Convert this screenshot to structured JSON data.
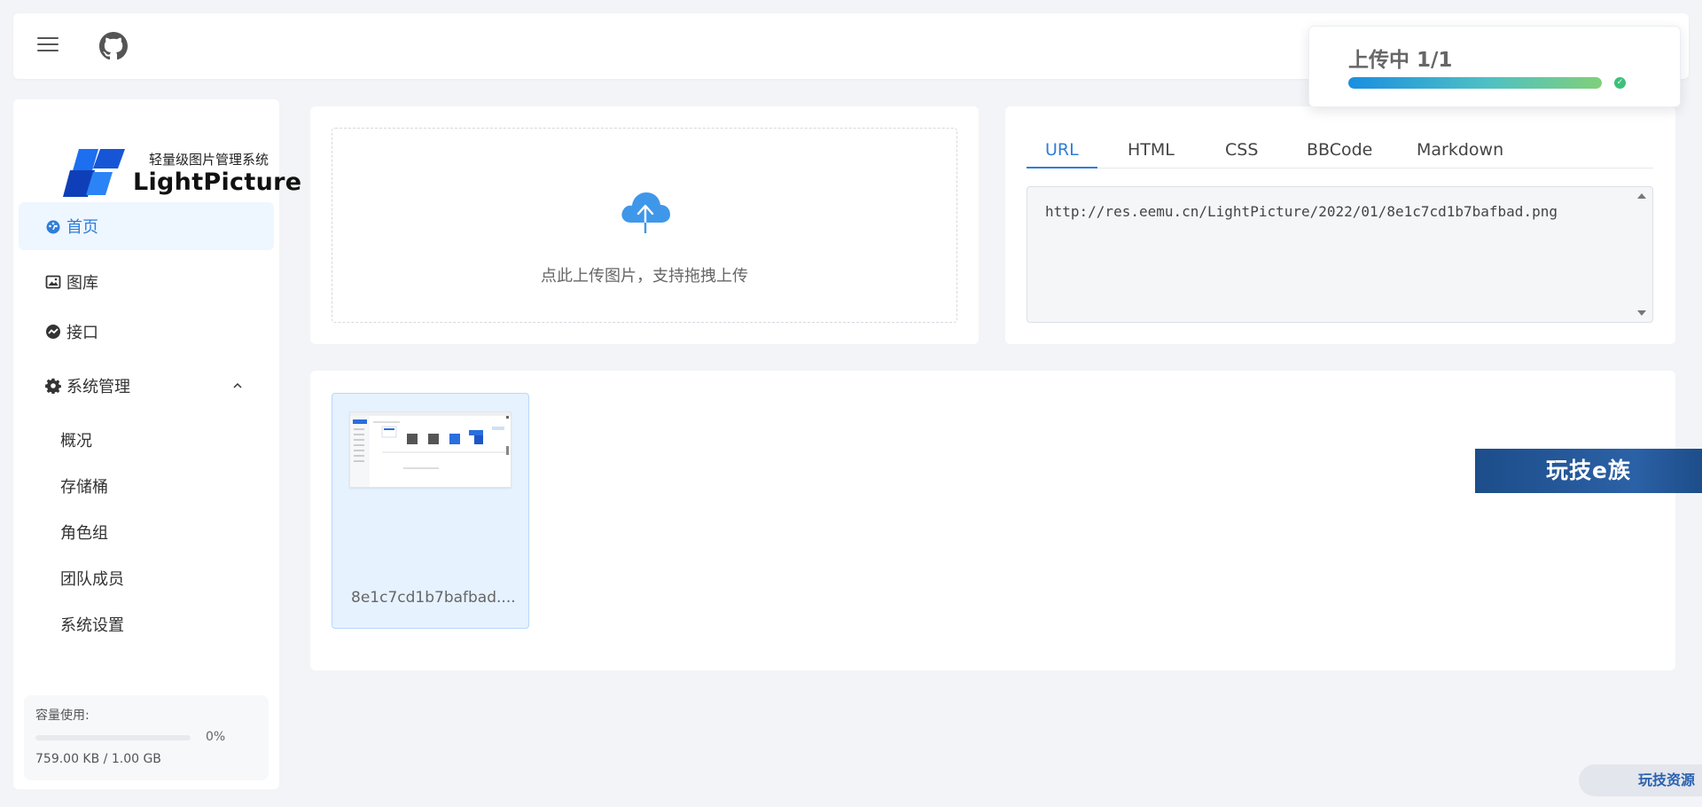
{
  "header": {
    "menu_icon": "hamburger-icon",
    "github_icon": "github-icon"
  },
  "toast": {
    "title": "上传中 1/1",
    "progress": 1.0,
    "status_icon": "check-circle-icon"
  },
  "logo": {
    "subtitle": "轻量级图片管理系统",
    "name": "LightPicture"
  },
  "sidebar": {
    "items": [
      {
        "label": "首页",
        "icon": "dashboard-icon",
        "active": true
      },
      {
        "label": "图库",
        "icon": "image-icon"
      },
      {
        "label": "接口",
        "icon": "api-icon"
      },
      {
        "label": "系统管理",
        "icon": "gear-icon",
        "expanded": true
      }
    ],
    "subitems": [
      "概况",
      "存储桶",
      "角色组",
      "团队成员",
      "系统设置"
    ]
  },
  "storage": {
    "label": "容量使用:",
    "percent": "0%",
    "percent_value": 0,
    "size": "759.00 KB / 1.00 GB"
  },
  "upload": {
    "icon": "cloud-upload-icon",
    "hint": "点此上传图片，支持拖拽上传"
  },
  "links": {
    "tabs": [
      "URL",
      "HTML",
      "CSS",
      "BBCode",
      "Markdown"
    ],
    "active_tab": 0,
    "value": "http://res.eemu.cn/LightPicture/2022/01/8e1c7cd1b7bafbad.png"
  },
  "gallery": {
    "items": [
      {
        "name": "8e1c7cd1b7bafbad...."
      }
    ]
  },
  "watermarks": {
    "banner": "玩技e族",
    "corner": "玩技资源"
  },
  "colors": {
    "accent": "#2f7ed8",
    "background": "#f3f4f7",
    "active_bg": "#eef6ff",
    "selected_thumb": "#e6f2fe",
    "success": "#3cc07a"
  }
}
